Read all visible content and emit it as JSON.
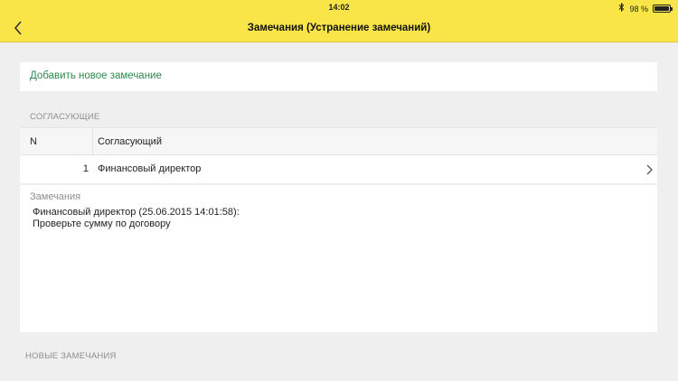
{
  "status_bar": {
    "time": "14:02",
    "battery_text": "98 %",
    "battery_level": 0.98,
    "bluetooth_icon": "bluetooth-icon"
  },
  "nav": {
    "title": "Замечания (Устранение замечаний)",
    "back_icon": "chevron-left-icon"
  },
  "add_remark": {
    "label": "Добавить новое замечание"
  },
  "approvers": {
    "section_title": "СОГЛАСУЮЩИЕ",
    "columns": [
      "N",
      "Согласующий"
    ],
    "rows": [
      {
        "n": "1",
        "name": "Финансовый директор"
      }
    ]
  },
  "remarks": {
    "label": "Замечания",
    "text": "Финансовый директор (25.06.2015 14:01:58):\nПроверьте сумму по договору"
  },
  "new_remarks": {
    "section_title": "НОВЫЕ ЗАМЕЧАНИЯ"
  },
  "colors": {
    "header_bg": "#f9e547",
    "link": "#2c8c4e",
    "background": "#efefef"
  }
}
